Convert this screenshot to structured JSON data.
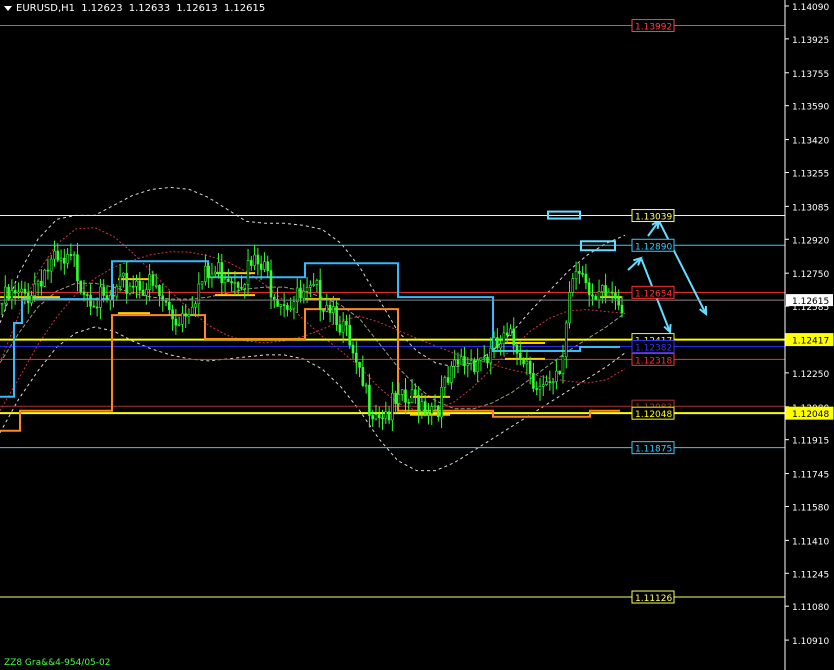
{
  "header": {
    "symbol": "EURUSD,H1",
    "open": "1.12623",
    "high": "1.12633",
    "low": "1.12613",
    "close": "1.12615"
  },
  "footer": {
    "text": "ZZ8 Gra&&4-954/05-02"
  },
  "chart_data": {
    "type": "candlestick",
    "symbol": "EURUSD",
    "timeframe": "H1",
    "ylim": [
      1.1076,
      1.1412
    ],
    "y_ticks": [
      "1.14090",
      "1.13925",
      "1.13755",
      "1.13590",
      "1.13420",
      "1.13255",
      "1.13085",
      "1.12920",
      "1.12750",
      "1.12585",
      "1.12415",
      "1.12250",
      "1.12080",
      "1.11915",
      "1.11745",
      "1.11580",
      "1.11410",
      "1.11245",
      "1.11080",
      "1.10910"
    ],
    "current_price": {
      "label": "1.12615",
      "value": 1.12615,
      "color": "#ffffff"
    },
    "levels": [
      {
        "label": "1.13992",
        "value": 1.13992,
        "color": "#ff4040",
        "width": 1,
        "tag": true
      },
      {
        "label": "1.13039",
        "value": 1.13039,
        "color": "#ffff66",
        "width": 1,
        "tag": true
      },
      {
        "label": "1.12890",
        "value": 1.1289,
        "color": "#33ccff",
        "width": 1,
        "tag": true
      },
      {
        "label": "1.12654",
        "value": 1.12654,
        "color": "#ff3030",
        "width": 1,
        "tag": true
      },
      {
        "label": "1.12417",
        "value": 1.12417,
        "color": "#ffff00",
        "width": 2,
        "tag": true
      },
      {
        "label": "1.12382",
        "value": 1.12382,
        "color": "#3333ff",
        "width": 1,
        "tag": true
      },
      {
        "label": "1.12318",
        "value": 1.12318,
        "color": "#ff3030",
        "width": 1,
        "tag": true
      },
      {
        "label": "1.12083",
        "value": 1.12083,
        "color": "#aa3333",
        "width": 1,
        "tag": true
      },
      {
        "label": "1.12048",
        "value": 1.12048,
        "color": "#ffff00",
        "width": 2,
        "tag": true
      },
      {
        "label": "1.11875",
        "value": 1.11875,
        "color": "#33ccff",
        "width": 1,
        "tag": true
      },
      {
        "label": "1.11126",
        "value": 1.11126,
        "color": "#ffff66",
        "width": 1,
        "tag": true
      }
    ],
    "close_path": [
      1.126,
      1.1262,
      1.1262,
      1.1268,
      1.1276,
      1.1279,
      1.1277,
      1.128,
      1.127,
      1.1265,
      1.1258,
      1.1262,
      1.1268,
      1.1272,
      1.127,
      1.1266,
      1.1259,
      1.1252,
      1.1257,
      1.1266,
      1.1272,
      1.1275,
      1.1277,
      1.1274,
      1.1276,
      1.1279,
      1.1274,
      1.1266,
      1.1262,
      1.1261,
      1.1262,
      1.1264,
      1.1263,
      1.1256,
      1.124,
      1.1222,
      1.1212,
      1.1207,
      1.1206,
      1.1208,
      1.121,
      1.1212,
      1.1209,
      1.1211,
      1.122,
      1.1229,
      1.1232,
      1.1234,
      1.1233,
      1.1239,
      1.124,
      1.1238,
      1.1228,
      1.1216,
      1.1214,
      1.1226,
      1.1275,
      1.1283,
      1.1255,
      1.1262,
      1.1266,
      1.1262
    ],
    "envelope_mid": [
      1.123,
      1.1245,
      1.1258,
      1.1266,
      1.127,
      1.127,
      1.1268,
      1.1265,
      1.1263,
      1.1262,
      1.1262,
      1.1263,
      1.1265,
      1.1267,
      1.1268,
      1.1268,
      1.1266,
      1.1263,
      1.1259,
      1.1252,
      1.124,
      1.1228,
      1.1218,
      1.1211,
      1.1207,
      1.1207,
      1.121,
      1.1215,
      1.1222,
      1.1229,
      1.1236,
      1.1242,
      1.1248,
      1.1255
    ],
    "envelope_outer_upper": [
      1.125,
      1.1275,
      1.1292,
      1.1302,
      1.1304,
      1.1304,
      1.1309,
      1.1314,
      1.1317,
      1.1318,
      1.1317,
      1.1313,
      1.1307,
      1.1301,
      1.13,
      1.13,
      1.1299,
      1.1297,
      1.129,
      1.1278,
      1.1262,
      1.1246,
      1.1236,
      1.123,
      1.1228,
      1.123,
      1.1236,
      1.1245,
      1.1256,
      1.1266,
      1.1276,
      1.1284,
      1.129,
      1.1294
    ],
    "envelope_outer_lower": [
      1.1195,
      1.1212,
      1.1226,
      1.1238,
      1.1245,
      1.1248,
      1.1246,
      1.1241,
      1.1237,
      1.1234,
      1.1232,
      1.1231,
      1.1232,
      1.1233,
      1.1234,
      1.1234,
      1.1232,
      1.1227,
      1.1218,
      1.1206,
      1.1192,
      1.1181,
      1.1176,
      1.1176,
      1.118,
      1.1186,
      1.1192,
      1.1198,
      1.1204,
      1.121,
      1.1216,
      1.1222,
      1.1228,
      1.1235
    ],
    "arrows_color": "#66ddff",
    "arrows": [
      {
        "from": [
          1.1262,
          1
        ],
        "to": [
          1.1283,
          4
        ]
      },
      {
        "from": [
          1.1283,
          4
        ],
        "to": [
          1.1252,
          9
        ]
      },
      {
        "from": [
          1.1283,
          6
        ],
        "to": [
          1.1301,
          7
        ]
      },
      {
        "from": [
          1.1301,
          7
        ],
        "to": [
          1.1256,
          17
        ]
      }
    ],
    "boxes": [
      {
        "price": 1.13039,
        "label": ""
      },
      {
        "price": 1.1289,
        "label": ""
      }
    ]
  }
}
